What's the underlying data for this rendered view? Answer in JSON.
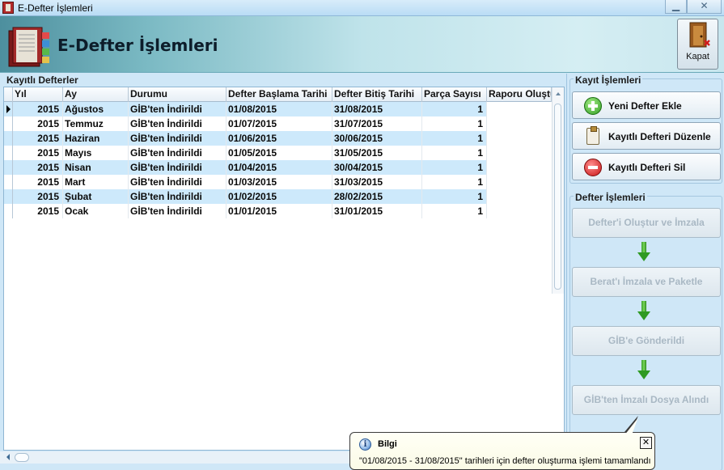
{
  "window": {
    "title": "E-Defter İşlemleri",
    "minimize_icon": "minimize-icon",
    "close_label": "✕"
  },
  "header": {
    "page_title": "E-Defter İşlemleri",
    "close_tile_label": "Kapat",
    "accent": "#5e9fae"
  },
  "grid": {
    "group_title": "Kayıtlı Defterler",
    "columns": [
      "Yıl",
      "Ay",
      "Durumu",
      "Defter Başlama Tarihi",
      "Defter Bitiş Tarihi",
      "Parça Sayısı",
      "Raporu Oluştu"
    ],
    "rows": [
      {
        "yil": "2015",
        "ay": "Ağustos",
        "durum": "GİB'ten İndirildi",
        "baslama": "01/08/2015",
        "bitis": "31/08/2015",
        "parca": "1"
      },
      {
        "yil": "2015",
        "ay": "Temmuz",
        "durum": "GİB'ten İndirildi",
        "baslama": "01/07/2015",
        "bitis": "31/07/2015",
        "parca": "1"
      },
      {
        "yil": "2015",
        "ay": "Haziran",
        "durum": "GİB'ten İndirildi",
        "baslama": "01/06/2015",
        "bitis": "30/06/2015",
        "parca": "1"
      },
      {
        "yil": "2015",
        "ay": "Mayıs",
        "durum": "GİB'ten İndirildi",
        "baslama": "01/05/2015",
        "bitis": "31/05/2015",
        "parca": "1"
      },
      {
        "yil": "2015",
        "ay": "Nisan",
        "durum": "GİB'ten İndirildi",
        "baslama": "01/04/2015",
        "bitis": "30/04/2015",
        "parca": "1"
      },
      {
        "yil": "2015",
        "ay": "Mart",
        "durum": "GİB'ten İndirildi",
        "baslama": "01/03/2015",
        "bitis": "31/03/2015",
        "parca": "1"
      },
      {
        "yil": "2015",
        "ay": "Şubat",
        "durum": "GİB'ten İndirildi",
        "baslama": "01/02/2015",
        "bitis": "28/02/2015",
        "parca": "1"
      },
      {
        "yil": "2015",
        "ay": "Ocak",
        "durum": "GİB'ten İndirildi",
        "baslama": "01/01/2015",
        "bitis": "31/01/2015",
        "parca": "1"
      }
    ],
    "selected_row_index": 0,
    "alt_row_color": "#cde9fb"
  },
  "records": {
    "group_title": "Kayıt İşlemleri",
    "add_label": "Yeni Defter Ekle",
    "edit_label": "Kayıtlı Defteri Düzenle",
    "delete_label": "Kayıtlı Defteri Sil"
  },
  "ledger": {
    "group_title": "Defter İşlemleri",
    "steps": [
      "Defter'i Oluştur ve İmzala",
      "Berat'ı İmzala ve Paketle",
      "GİB'e Gönderildi",
      "GİB'ten İmzalı Dosya Alındı"
    ],
    "disabled_color": "#a9b8c4"
  },
  "balloon": {
    "title": "Bilgi",
    "text": "\"01/08/2015 - 31/08/2015\" tarihleri için defter oluşturma işlemi tamamlandı",
    "close_label": "✕",
    "info_glyph": "i"
  }
}
